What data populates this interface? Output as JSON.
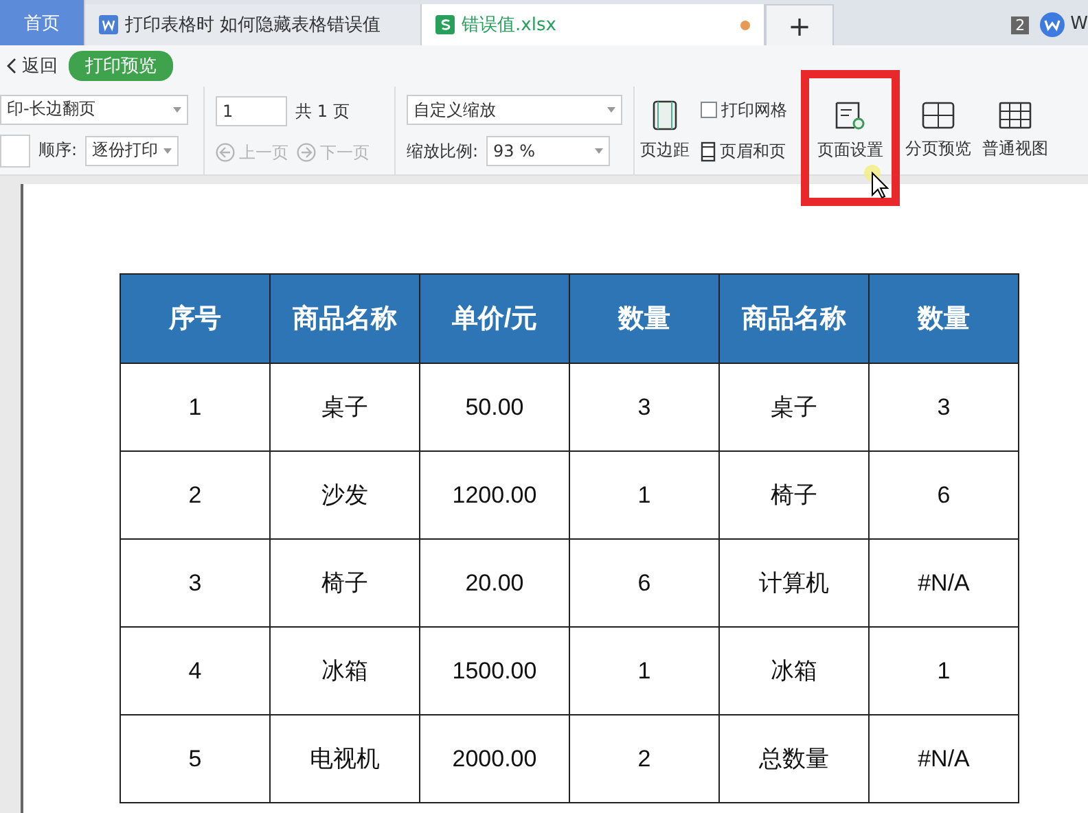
{
  "tabs": [
    {
      "label": "首页",
      "kind": "home",
      "selected": false
    },
    {
      "label": "打印表格时 如何隐藏表格错误值",
      "kind": "doc",
      "selected": false
    },
    {
      "label": "错误值.xlsx",
      "kind": "sheet",
      "selected": true,
      "modified": true
    }
  ],
  "new_tab": "+",
  "window_count": "2",
  "account_text": "W",
  "toolbar": {
    "back": "返回",
    "mode": "打印预览",
    "print_mode": "印-长边翻页",
    "order_label": "顺序:",
    "order": "逐份打印",
    "page": "1",
    "page_total": "共 1 页",
    "prev": {
      "label": "上一页",
      "disabled": true
    },
    "next": {
      "label": "下一页",
      "disabled": true
    },
    "zoom_mode": "自定义缩放",
    "zoom_label": "缩放比例:",
    "zoom": "93 %",
    "margins": "页边距",
    "gridlines": {
      "label": "打印网格",
      "checked": false
    },
    "header_footer": "页眉和页",
    "tools": [
      {
        "kind": "page_setup",
        "label": "页面设置",
        "highlighted": true
      },
      {
        "kind": "page_break",
        "label": "分页预览",
        "highlighted": false
      },
      {
        "kind": "normal",
        "label": "普通视图",
        "highlighted": false
      }
    ]
  },
  "table": {
    "columns": [
      "序号",
      "商品名称",
      "单价/元",
      "数量",
      "商品名称",
      "数量"
    ],
    "rows": [
      [
        "1",
        "桌子",
        "50.00",
        "3",
        "桌子",
        "3"
      ],
      [
        "2",
        "沙发",
        "1200.00",
        "1",
        "椅子",
        "6"
      ],
      [
        "3",
        "椅子",
        "20.00",
        "6",
        "计算机",
        "#N/A"
      ],
      [
        "4",
        "冰箱",
        "1500.00",
        "1",
        "冰箱",
        "1"
      ],
      [
        "5",
        "电视机",
        "2000.00",
        "2",
        "总数量",
        "#N/A"
      ]
    ]
  }
}
